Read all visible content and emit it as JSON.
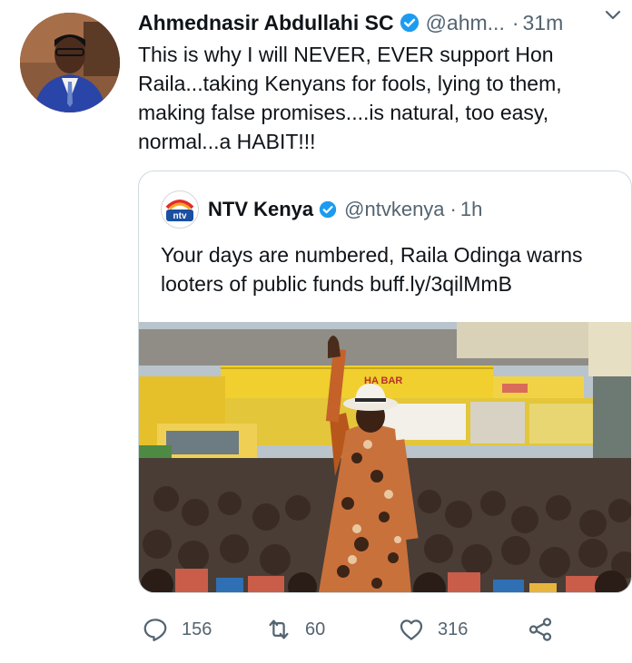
{
  "tweet": {
    "author_name": "Ahmednasir Abdullahi SC",
    "author_handle": "@ahm...",
    "separator": "·",
    "time": "31m",
    "text": "This is why I will NEVER, EVER support Hon Raila...taking Kenyans for fools, lying to them, making false promises....is natural, too easy, normal...a HABIT!!!"
  },
  "quote": {
    "author_name": "NTV Kenya",
    "author_handle": "@ntvkenya",
    "separator": "·",
    "time": "1h",
    "text": "Your days are numbered, Raila Odinga warns looters of public funds buff.ly/3qilMmB",
    "avatar_logo_text": "ntv",
    "image_sign_text": "HA BAR"
  },
  "actions": {
    "replies": "156",
    "retweets": "60",
    "likes": "316"
  },
  "icons": {
    "verified": "verified-badge-icon",
    "caret": "chevron-down-icon",
    "reply": "reply-icon",
    "retweet": "retweet-icon",
    "like": "heart-icon",
    "share": "share-icon"
  },
  "colors": {
    "verified_blue": "#1d9bf0",
    "text_primary": "#0f1419",
    "text_secondary": "#536471",
    "border": "#cfd9de"
  }
}
